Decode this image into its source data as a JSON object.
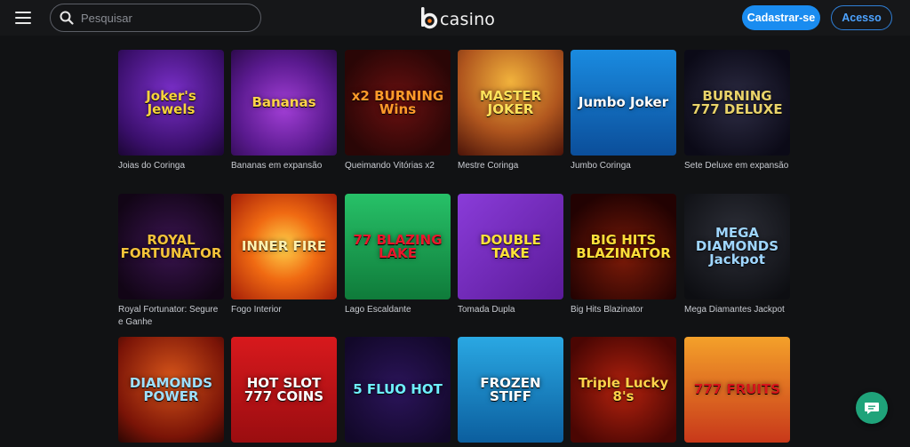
{
  "header": {
    "search_placeholder": "Pesquisar",
    "logo_text": "casino",
    "signup_label": "Cadastrar-se",
    "login_label": "Acesso"
  },
  "colors": {
    "accent": "#1a8cf0",
    "background": "#111214",
    "chat": "#1fa37a"
  },
  "games": [
    {
      "name": "Joias do Coringa",
      "art_text": "Joker's Jewels",
      "art": "g-jokers",
      "art_color": "#f7d33b"
    },
    {
      "name": "Bananas em expansão",
      "art_text": "Bananas",
      "art": "g-bananas",
      "art_color": "#ffd34a"
    },
    {
      "name": "Queimando Vitórias x2",
      "art_text": "x2 BURNING Wins",
      "art": "g-burning",
      "art_color": "#ff9a2a"
    },
    {
      "name": "Mestre Coringa",
      "art_text": "MASTER JOKER",
      "art": "g-master",
      "art_color": "#ffe25a"
    },
    {
      "name": "Jumbo Coringa",
      "art_text": "Jumbo Joker",
      "art": "g-jumbo",
      "art_color": "#ffffff"
    },
    {
      "name": "Sete Deluxe em expansão",
      "art_text": "BURNING 777 DELUXE",
      "art": "g-777",
      "art_color": "#e9d36a"
    },
    {
      "name": "Royal Fortunator: Segure e Ganhe",
      "art_text": "ROYAL FORTUNATOR",
      "art": "g-royal",
      "art_color": "#f4c33a"
    },
    {
      "name": "Fogo Interior",
      "art_text": "INNER FIRE",
      "art": "g-inner",
      "art_color": "#fff1b0"
    },
    {
      "name": "Lago Escaldante",
      "art_text": "77 BLAZING LAKE",
      "art": "g-blazing",
      "art_color": "#e8192c"
    },
    {
      "name": "Tomada Dupla",
      "art_text": "DOUBLE TAKE",
      "art": "g-double",
      "art_color": "#ffe23a"
    },
    {
      "name": "Big Hits Blazinator",
      "art_text": "BIG HITS BLAZINATOR",
      "art": "g-bighits",
      "art_color": "#ffdf3a"
    },
    {
      "name": "Mega Diamantes Jackpot",
      "art_text": "MEGA DIAMONDS Jackpot",
      "art": "g-mega",
      "art_color": "#9fd6ff"
    },
    {
      "name": "",
      "art_text": "DIAMONDS POWER",
      "art": "g-diamonds",
      "art_color": "#9fe0ff"
    },
    {
      "name": "",
      "art_text": "HOT SLOT 777 COINS",
      "art": "g-hotslot",
      "art_color": "#ffffff"
    },
    {
      "name": "",
      "art_text": "5 FLUO HOT",
      "art": "g-fluo",
      "art_color": "#6ef0ff"
    },
    {
      "name": "",
      "art_text": "FROZEN STIFF",
      "art": "g-frozen",
      "art_color": "#ffffff"
    },
    {
      "name": "",
      "art_text": "Triple Lucky 8's",
      "art": "g-triple",
      "art_color": "#ffd24a"
    },
    {
      "name": "",
      "art_text": "777 FRUITS",
      "art": "g-fruits",
      "art_color": "#d8151b"
    }
  ]
}
